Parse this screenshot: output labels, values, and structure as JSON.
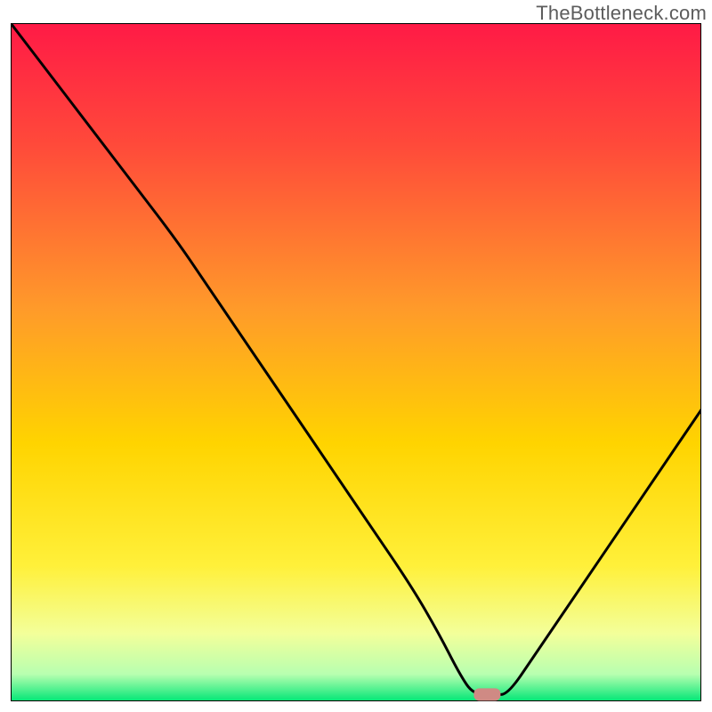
{
  "watermark": "TheBottleneck.com",
  "chart_data": {
    "type": "line",
    "title": "",
    "xlabel": "",
    "ylabel": "",
    "xlim": [
      0,
      100
    ],
    "ylim": [
      0,
      100
    ],
    "grid": false,
    "legend": false,
    "background_gradient": {
      "top_color": "#ff1a46",
      "mid_color": "#ffd400",
      "low_color": "#f3ff9a",
      "bottom_color": "#00e676"
    },
    "marker": {
      "x": 69,
      "y": 1,
      "color": "#cf8a84",
      "shape": "rounded-rect"
    },
    "series": [
      {
        "name": "curve",
        "x": [
          0,
          6,
          12,
          18,
          24,
          28,
          34,
          40,
          46,
          52,
          58,
          62,
          65,
          67,
          70,
          72,
          76,
          82,
          88,
          94,
          100
        ],
        "y": [
          100,
          92,
          84,
          76,
          68,
          62,
          53,
          44,
          35,
          26,
          17,
          10,
          4,
          1,
          1,
          1,
          7,
          16,
          25,
          34,
          43
        ]
      }
    ]
  }
}
